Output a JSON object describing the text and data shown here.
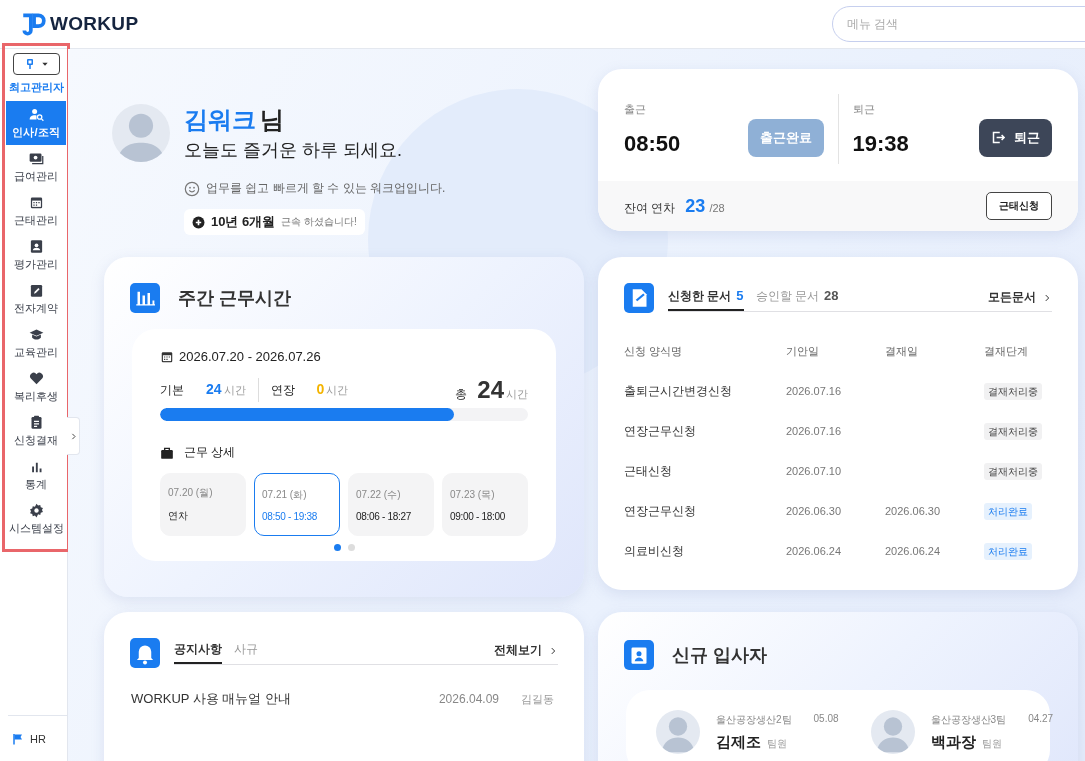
{
  "header": {
    "logo": "WORKUP",
    "search": {
      "placeholder": "메뉴 검색"
    }
  },
  "sidebar": {
    "role": "최고관리자",
    "items": [
      {
        "label": "인사/조직",
        "selected": true
      },
      {
        "label": "급여관리",
        "selected": false
      },
      {
        "label": "근태관리",
        "selected": false
      },
      {
        "label": "평가관리",
        "selected": false
      },
      {
        "label": "전자계약",
        "selected": false
      },
      {
        "label": "교육관리",
        "selected": false
      },
      {
        "label": "복리후생",
        "selected": false
      },
      {
        "label": "신청결재",
        "selected": false
      },
      {
        "label": "통계",
        "selected": false
      },
      {
        "label": "시스템설정",
        "selected": false
      }
    ],
    "footer": "HR"
  },
  "greeting": {
    "name": "김워크",
    "suffix": "님",
    "message": "오늘도 즐거운 하루 되세요.",
    "tagline": "업무를 쉽고 빠르게 할 수 있는 워크업입니다.",
    "tenure": "10년 6개월",
    "tenure_note": "근속 하셨습니다!"
  },
  "attendance": {
    "in_label": "출근",
    "in_time": "08:50",
    "in_button": {
      "label": "출근완료",
      "disabled": true
    },
    "out_label": "퇴근",
    "out_time": "19:38",
    "out_button": {
      "label": "퇴근",
      "disabled": false
    },
    "leave_label": "잔여 연차",
    "leave_remaining": "23",
    "leave_total": "/28",
    "request_button": "근태신청"
  },
  "weekly": {
    "title": "주간 근무시간",
    "range": "2026.07.20 - 2026.07.26",
    "basic_label": "기본",
    "basic_value": "24",
    "basic_unit": "시간",
    "overtime_label": "연장",
    "overtime_value": "0",
    "overtime_unit": "시간",
    "total_label": "총",
    "total_value": "24",
    "total_unit": "시간",
    "level": 0.8,
    "detail_title": "근무 상세",
    "days": [
      {
        "date": "07.20 (월)",
        "value": "연차",
        "selected": false
      },
      {
        "date": "07.21 (화)",
        "value": "08:50 - 19:38",
        "selected": true
      },
      {
        "date": "07.22 (수)",
        "value": "08:06 - 18:27",
        "selected": false
      },
      {
        "date": "07.23 (목)",
        "value": "09:00 - 18:00",
        "selected": false
      }
    ],
    "pages": [
      {
        "selected": true
      },
      {
        "selected": false
      }
    ]
  },
  "documents": {
    "tabs": [
      {
        "label": "신청한 문서",
        "count": "5",
        "selected": true
      },
      {
        "label": "승인할 문서",
        "count": "28",
        "selected": false
      }
    ],
    "more": "모든문서",
    "columns": [
      "신청 양식명",
      "기안일",
      "결재일",
      "결재단계"
    ],
    "rows": [
      {
        "name": "출퇴근시간변경신청",
        "drafted": "2026.07.16",
        "status": "결재처리중",
        "done": false
      },
      {
        "name": "연장근무신청",
        "drafted": "2026.07.16",
        "status": "결재처리중",
        "done": false
      },
      {
        "name": "근태신청",
        "drafted": "2026.07.10",
        "status": "결재처리중",
        "done": false
      },
      {
        "name": "연장근무신청",
        "drafted": "2026.06.30",
        "approved": "2026.06.30",
        "status": "처리완료",
        "done": true
      },
      {
        "name": "의료비신청",
        "drafted": "2026.06.24",
        "approved": "2026.06.24",
        "status": "처리완료",
        "done": true
      }
    ]
  },
  "notices": {
    "tabs": [
      {
        "label": "공지사항",
        "selected": true
      },
      {
        "label": "사규",
        "selected": false
      }
    ],
    "more": "전체보기",
    "rows": [
      {
        "title": "WORKUP 사용 매뉴얼 안내",
        "date": "2026.04.09",
        "author": "김길동"
      }
    ]
  },
  "new_hires": {
    "title": "신규 입사자",
    "people": [
      {
        "team": "울산공장생산2팀",
        "date": "05.08",
        "name": "김제조",
        "rank": "팀원"
      },
      {
        "team": "울산공장생산3팀",
        "date": "04.27",
        "name": "백과장",
        "rank": "팀원"
      }
    ]
  }
}
